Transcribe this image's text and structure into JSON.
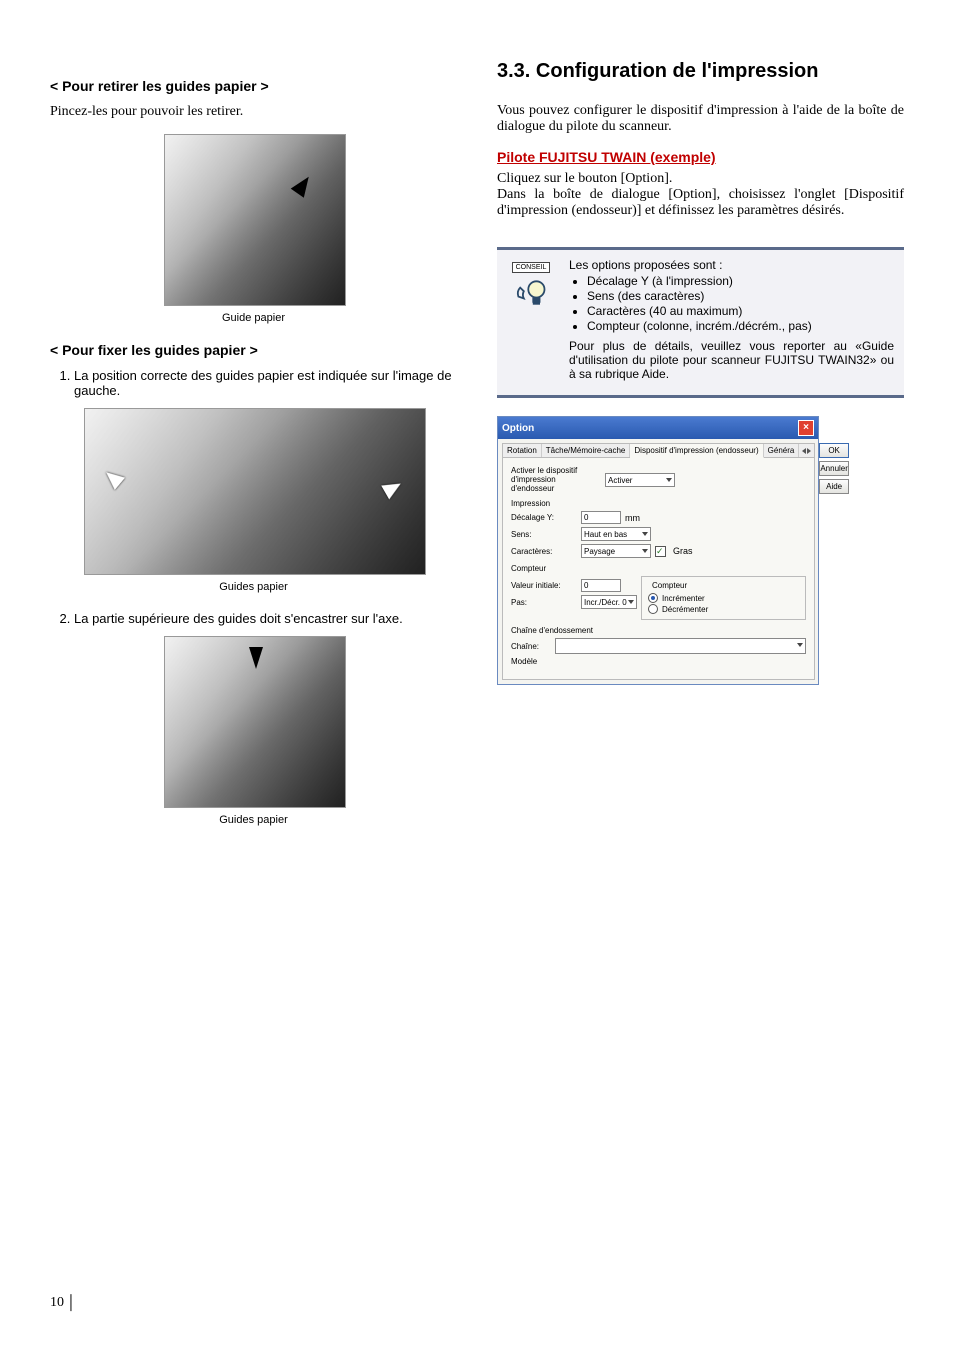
{
  "left": {
    "heading_remove": "< Pour retirer les guides papier >",
    "remove_text": "Pincez-les pour pouvoir les retirer.",
    "caption1": "Guide papier",
    "heading_fix": "< Pour fixer les guides papier >",
    "step1": "La position correcte des guides papier est indiquée sur l'image de gauche.",
    "caption2": "Guides papier",
    "step2": "La partie supérieure des guides doit s'encastrer sur l'axe.",
    "caption3": "Guides papier"
  },
  "right": {
    "section_title": "3.3. Configuration de l'impression",
    "intro": "Vous pouvez configurer le dispositif d'impression à l'aide de la boîte de dialogue du pilote du scanneur.",
    "driver_heading": "Pilote FUJITSU TWAIN (exemple)",
    "driver_p1": "Cliquez sur le bouton [Option].",
    "driver_p2": "Dans la boîte de dialogue [Option], choisissez l'onglet [Dispositif d'impression (endosseur)] et définissez les paramètres désirés.",
    "tip": {
      "label": "CONSEIL",
      "intro": "Les options proposées sont :",
      "items": [
        "Décalage Y (à l'impression)",
        "Sens (des caractères)",
        "Caractères (40 au maximum)",
        "Compteur (colonne, incrém./décrém., pas)"
      ],
      "more": "Pour plus de détails, veuillez vous reporter au «Guide d'utilisation du pilote pour scanneur FUJITSU TWAIN32» ou à sa rubrique Aide."
    },
    "dialog": {
      "title": "Option",
      "tabs": {
        "t1": "Rotation",
        "t2": "Tâche/Mémoire-cache",
        "t3": "Dispositif d'impression (endosseur)",
        "t4": "Généra"
      },
      "enable_label": "Activer le dispositif d'impression d'endosseur",
      "enable_value": "Activer",
      "impression": "Impression",
      "decalage_label": "Décalage Y:",
      "decalage_value": "0",
      "decalage_unit": "mm",
      "sens_label": "Sens:",
      "sens_value": "Haut en bas",
      "caracteres_label": "Caractères:",
      "caracteres_value": "Paysage",
      "gras_label": "Gras",
      "compteur_title": "Compteur",
      "valeur_label": "Valeur initiale:",
      "valeur_value": "0",
      "pas_label": "Pas:",
      "pas_value": "Incr./Décr. 0",
      "compteur_group": "Compteur",
      "radio_inc": "Incrémenter",
      "radio_dec": "Décrémenter",
      "chaine_title": "Chaîne d'endossement",
      "chaine_label": "Chaîne:",
      "modele_label": "Modèle",
      "btn_ok": "OK",
      "btn_cancel": "Annuler",
      "btn_help": "Aide"
    }
  },
  "page_number": "10"
}
